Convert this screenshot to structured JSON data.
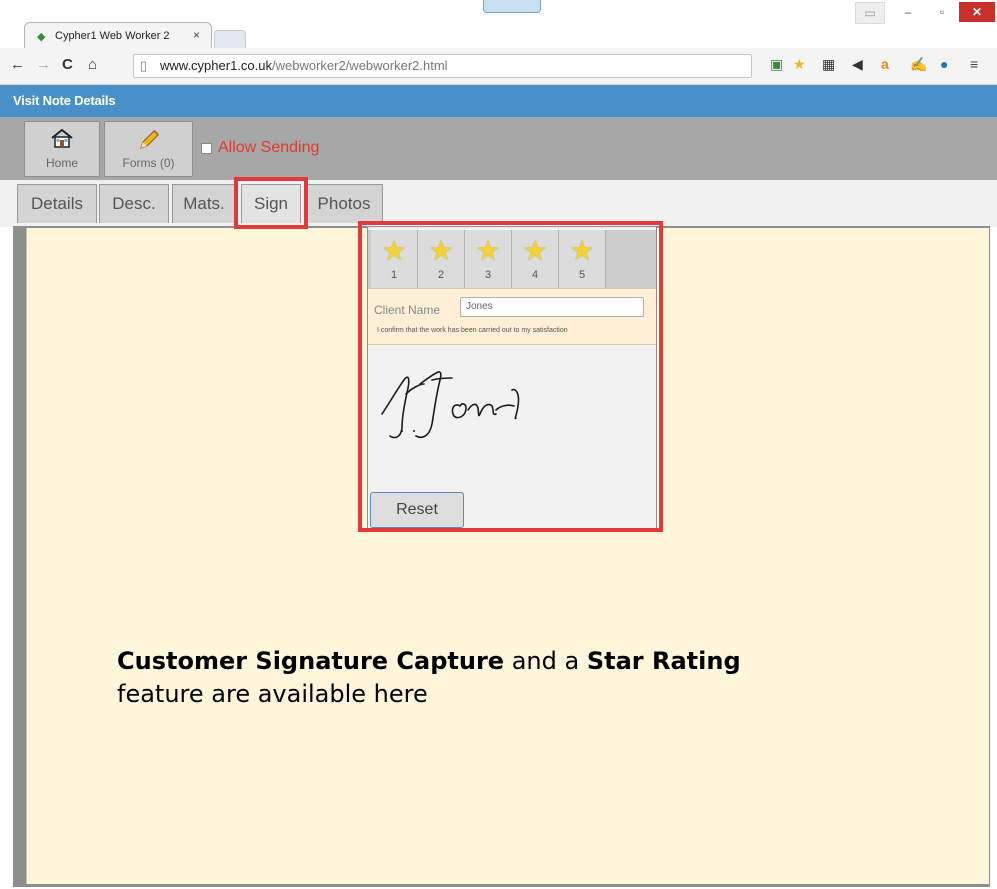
{
  "browser": {
    "tab_title": "Cypher1 Web Worker 2",
    "tab_close": "×",
    "url_host": "www.cypher1.co.uk",
    "url_path": "/webworker2/webworker2.html"
  },
  "app": {
    "header_title": "Visit Note Details",
    "toolbar": {
      "home_label": "Home",
      "forms_label": "Forms (0)",
      "allow_sending_label": "Allow Sending"
    },
    "tabs": [
      {
        "label": "Details"
      },
      {
        "label": "Desc."
      },
      {
        "label": "Mats."
      },
      {
        "label": "Sign"
      },
      {
        "label": "Photos"
      }
    ],
    "active_tab": "Sign",
    "sign": {
      "star_numbers": [
        "1",
        "2",
        "3",
        "4",
        "5"
      ],
      "client_name_label": "Client Name",
      "client_name_value": "Jones",
      "confirm_text": "I confirm that the work has been carried out to my satisfaction",
      "reset_label": "Reset"
    }
  },
  "caption": {
    "part1_bold": "Customer Signature Capture",
    "part2": " and a ",
    "part3_bold": "Star Rating",
    "part4": " feature are available here"
  },
  "colors": {
    "app_header": "#4a90c8",
    "highlight": "#e03a3a",
    "allow_sending": "#e03a2e",
    "content_bg": "#fef6da"
  }
}
